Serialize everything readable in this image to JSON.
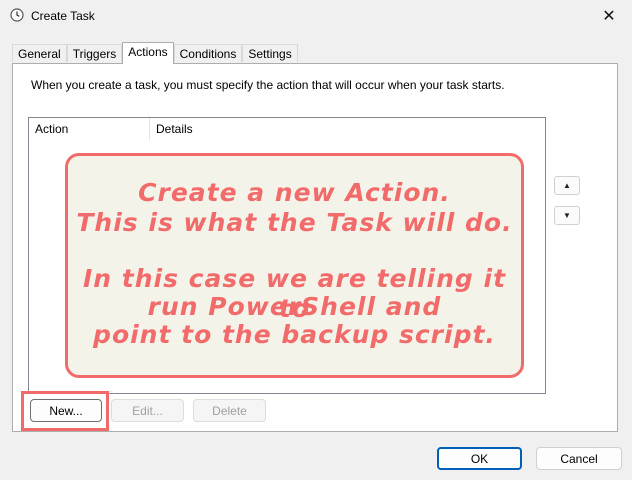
{
  "window": {
    "title": "Create Task",
    "icon": "clock-icon",
    "close_glyph": "✕"
  },
  "tabs": [
    {
      "label": "General"
    },
    {
      "label": "Triggers"
    },
    {
      "label": "Actions",
      "active": true
    },
    {
      "label": "Conditions"
    },
    {
      "label": "Settings"
    }
  ],
  "actions_tab": {
    "description": "When you create a task, you must specify the action that will occur when your task starts.",
    "columns": [
      "Action",
      "Details"
    ],
    "rows": [],
    "move_up_glyph": "▲",
    "move_down_glyph": "▼",
    "buttons": {
      "new": "New...",
      "edit": "Edit...",
      "delete": "Delete"
    }
  },
  "annotation": {
    "color": "#f26b6b",
    "lines": [
      "Create a new Action.",
      "This is what the Task will do.",
      "",
      "In this case we are telling it to",
      "run PowerShell and",
      "point to the backup script."
    ]
  },
  "dialog_buttons": {
    "ok": "OK",
    "cancel": "Cancel"
  },
  "colors": {
    "accent": "#005fb8",
    "annotation": "#f26b6b",
    "callout_bg": "#f4f3ea"
  }
}
